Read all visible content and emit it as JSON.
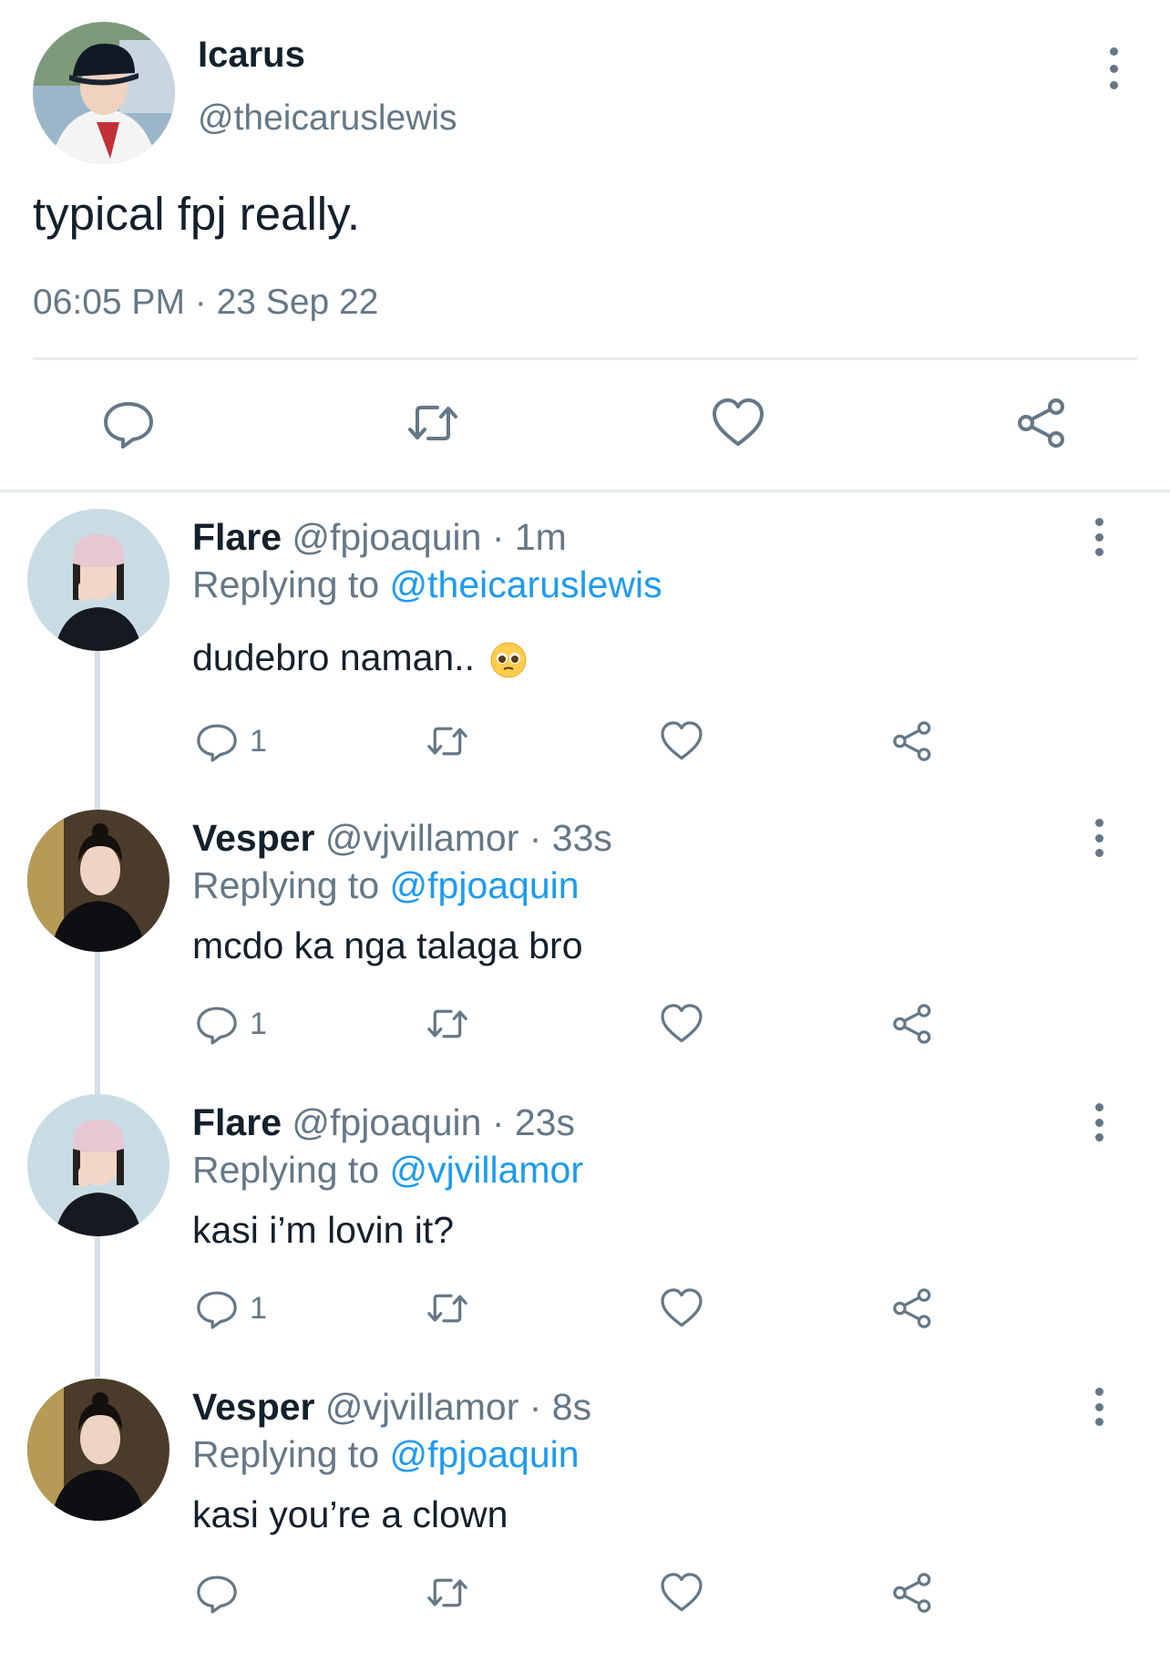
{
  "main_tweet": {
    "name": "Icarus",
    "handle": "@theicaruslewis",
    "text": "typical fpj really.",
    "timestamp": "06:05 PM · 23 Sep 22",
    "actions": [
      "reply-icon",
      "retweet-icon",
      "like-icon",
      "share-icon"
    ]
  },
  "replies": [
    {
      "name": "Flare",
      "meta": "@fpjoaquin · 1m",
      "replying_prefix": "Replying to",
      "replying_to": "@theicaruslewis",
      "text": "dudebro naman..",
      "emoji": "pleading-face-emoji",
      "reply_count": "1"
    },
    {
      "name": "Vesper",
      "meta": "@vjvillamor · 33s",
      "replying_prefix": "Replying to",
      "replying_to": "@fpjoaquin",
      "text": "mcdo ka nga talaga bro",
      "reply_count": "1"
    },
    {
      "name": "Flare",
      "meta": "@fpjoaquin · 23s",
      "replying_prefix": "Replying to",
      "replying_to": "@vjvillamor",
      "text": "kasi i’m lovin it?",
      "reply_count": "1"
    },
    {
      "name": "Vesper",
      "meta": "@vjvillamor · 8s",
      "replying_prefix": "Replying to",
      "replying_to": "@fpjoaquin",
      "text": "kasi you’re a clown",
      "reply_count": ""
    }
  ],
  "colors": {
    "text": "#14202b",
    "secondary": "#657786",
    "link": "#1d9bf0",
    "divider": "#e6ecf0"
  }
}
